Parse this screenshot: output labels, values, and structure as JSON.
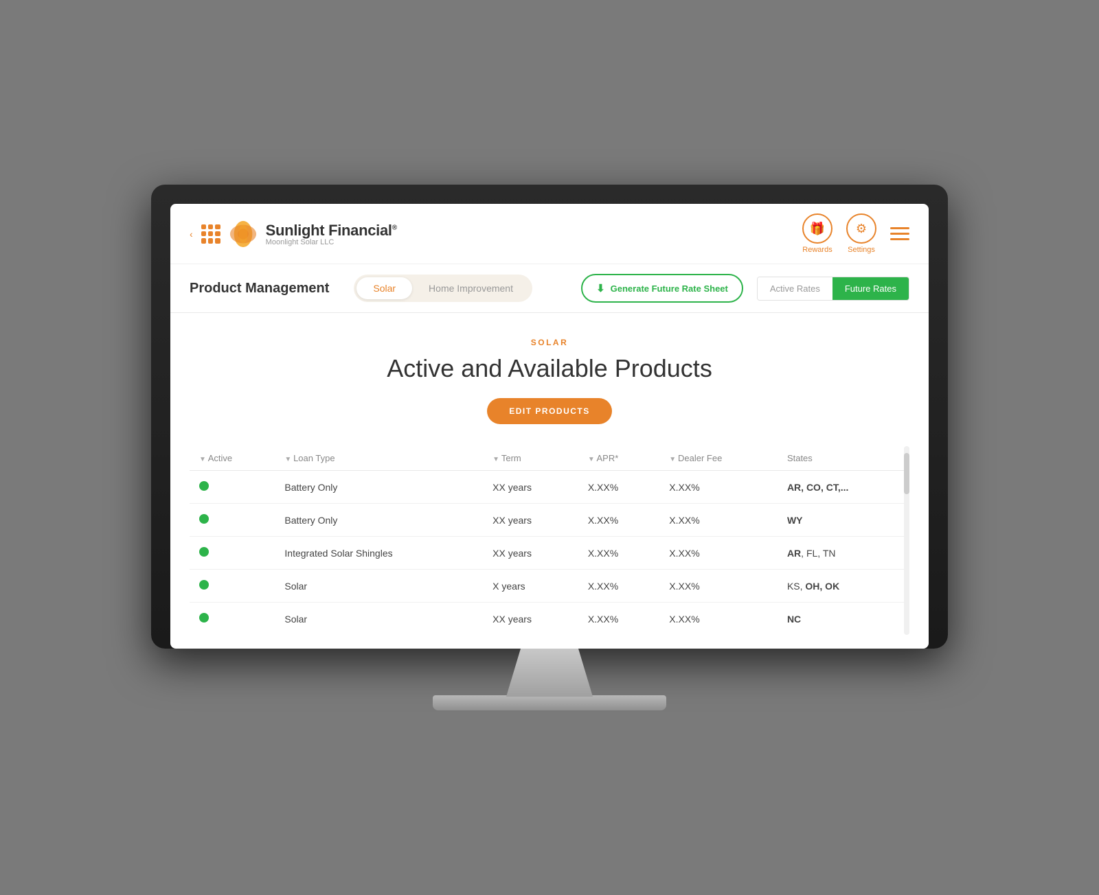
{
  "brand": {
    "name": "Sunlight Financial",
    "trademark": "®",
    "sub": "Moonlight Solar LLC"
  },
  "header": {
    "rewards_label": "Rewards",
    "settings_label": "Settings"
  },
  "toolbar": {
    "page_title": "Product Management",
    "tab_solar": "Solar",
    "tab_home": "Home Improvement",
    "generate_btn": "Generate Future Rate Sheet",
    "active_rates": "Active Rates",
    "future_rates": "Future Rates"
  },
  "section": {
    "label": "SOLAR",
    "title": "Active and Available Products",
    "edit_btn": "EDIT PRODUCTS"
  },
  "table": {
    "columns": [
      {
        "id": "active",
        "label": "Active"
      },
      {
        "id": "loan_type",
        "label": "Loan Type"
      },
      {
        "id": "term",
        "label": "Term"
      },
      {
        "id": "apr",
        "label": "APR*"
      },
      {
        "id": "dealer_fee",
        "label": "Dealer Fee"
      },
      {
        "id": "states",
        "label": "States"
      }
    ],
    "rows": [
      {
        "active": true,
        "loan_type": "Battery Only",
        "term": "XX years",
        "apr": "X.XX%",
        "dealer_fee": "X.XX%",
        "states": "AR, CO, CT,...",
        "states_bold": true
      },
      {
        "active": true,
        "loan_type": "Battery Only",
        "term": "XX years",
        "apr": "X.XX%",
        "dealer_fee": "X.XX%",
        "states": "WY",
        "states_bold": true
      },
      {
        "active": true,
        "loan_type": "Integrated Solar Shingles",
        "term": "XX years",
        "apr": "X.XX%",
        "dealer_fee": "X.XX%",
        "states": "AR, FL, TN",
        "states_bold_parts": [
          "AR"
        ]
      },
      {
        "active": true,
        "loan_type": "Solar",
        "term": "X years",
        "apr": "X.XX%",
        "dealer_fee": "X.XX%",
        "states": "KS, OH, OK",
        "states_bold_parts": [
          "OH",
          "OK"
        ]
      },
      {
        "active": true,
        "loan_type": "Solar",
        "term": "XX years",
        "apr": "X.XX%",
        "dealer_fee": "X.XX%",
        "states": "NC",
        "states_bold": true
      }
    ]
  }
}
